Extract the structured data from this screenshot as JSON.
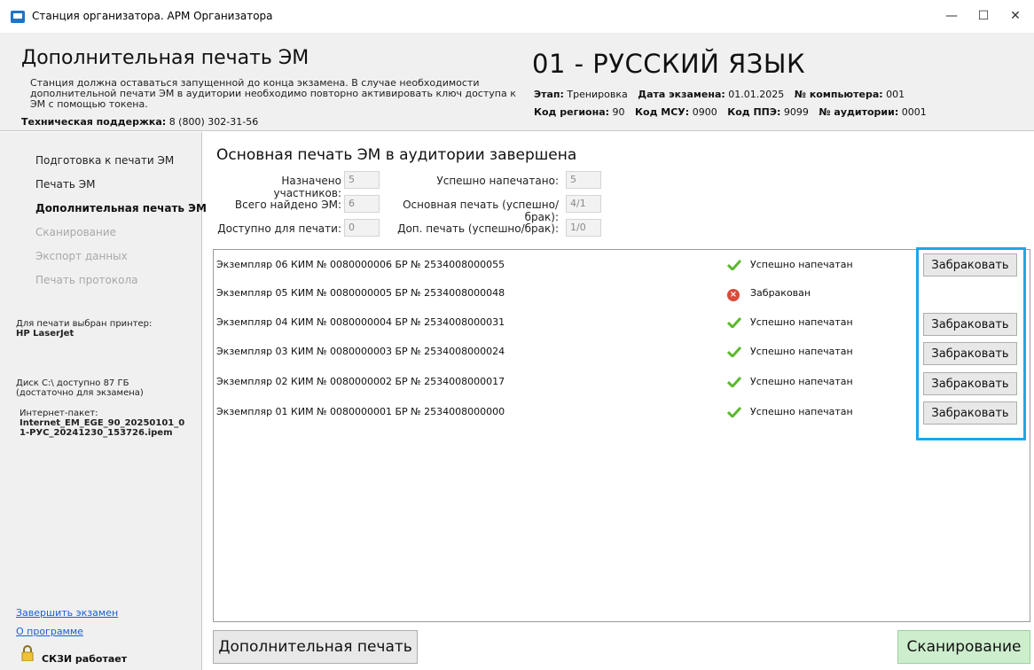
{
  "window": {
    "title": "Станция организатора. АРМ Организатора",
    "min": "—",
    "max": "☐",
    "close": "✕"
  },
  "header": {
    "title": "Дополнительная печать ЭМ",
    "desc": "Станция должна оставаться запущенной до конца экзамена. В случае необходимости дополнительной печати ЭМ в аудитории необходимо повторно активировать ключ доступа к ЭМ с помощью токена.",
    "support_label": "Техническая поддержка:",
    "support_value": "8 (800) 302-31-56",
    "subject": "01 - РУССКИЙ ЯЗЫК",
    "meta": {
      "stage_label": "Этап:",
      "stage_value": "Тренировка",
      "date_label": "Дата экзамена:",
      "date_value": "01.01.2025",
      "pc_label": "№ компьютера:",
      "pc_value": "001",
      "region_label": "Код региона:",
      "region_value": "90",
      "msu_label": "Код МСУ:",
      "msu_value": "0900",
      "ppe_label": "Код ППЭ:",
      "ppe_value": "9099",
      "room_label": "№ аудитории:",
      "room_value": "0001"
    }
  },
  "sidebar": {
    "items": [
      {
        "label": "Подготовка к печати ЭМ"
      },
      {
        "label": "Печать ЭМ"
      },
      {
        "label": "Дополнительная печать ЭМ"
      },
      {
        "label": "Сканирование"
      },
      {
        "label": "Экспорт данных"
      },
      {
        "label": "Печать протокола"
      }
    ],
    "printer_label": "Для печати выбран принтер:",
    "printer_name": "HP LaserJet",
    "disk_line1": "Диск C:\\ доступно 87 ГБ",
    "disk_line2": "(достаточно для экзамена)",
    "package_label": "Интернет-пакет:",
    "package_line1": "Internet_EM_EGE_90_20250101_0",
    "package_line2": "1-РУС_20241230_153726.ipem",
    "finish_link": "Завершить экзамен",
    "about_link": "О программе",
    "skzi": "СКЗИ работает"
  },
  "main": {
    "title": "Основная печать ЭМ в аудитории завершена",
    "stats": {
      "assigned_label": "Назначено участников:",
      "assigned_value": "5",
      "found_label": "Всего найдено ЭМ:",
      "found_value": "6",
      "available_label": "Доступно для печати:",
      "available_value": "0",
      "printed_label": "Успешно напечатано:",
      "printed_value": "5",
      "main_print_label": "Основная печать (успешно/брак):",
      "main_print_value": "4/1",
      "extra_print_label": "Доп. печать (успешно/брак):",
      "extra_print_value": "1/0"
    },
    "rows": [
      {
        "text": "Экземпляр 06  КИМ № 0080000006  БР № 2534008000055",
        "status": "Успешно напечатан",
        "button": "Забраковать"
      },
      {
        "text": "Экземпляр 05  КИМ № 0080000005  БР № 2534008000048",
        "status": "Забракован"
      },
      {
        "text": "Экземпляр 04  КИМ № 0080000004  БР № 2534008000031",
        "status": "Успешно напечатан",
        "button": "Забраковать"
      },
      {
        "text": "Экземпляр 03  КИМ № 0080000003  БР № 2534008000024",
        "status": "Успешно напечатан",
        "button": "Забраковать"
      },
      {
        "text": "Экземпляр 02  КИМ № 0080000002  БР № 2534008000017",
        "status": "Успешно напечатан",
        "button": "Забраковать"
      },
      {
        "text": "Экземпляр 01  КИМ № 0080000001  БР № 2534008000000",
        "status": "Успешно напечатан",
        "button": "Забраковать"
      }
    ],
    "extra_print_button": "Дополнительная печать",
    "scan_button": "Сканирование"
  },
  "colors": {
    "accent_highlight": "#1ba7e8",
    "link": "#1a5fd6",
    "success": "#5cb82e",
    "error": "#d94b3c",
    "scan_button": "#cdeecd"
  }
}
